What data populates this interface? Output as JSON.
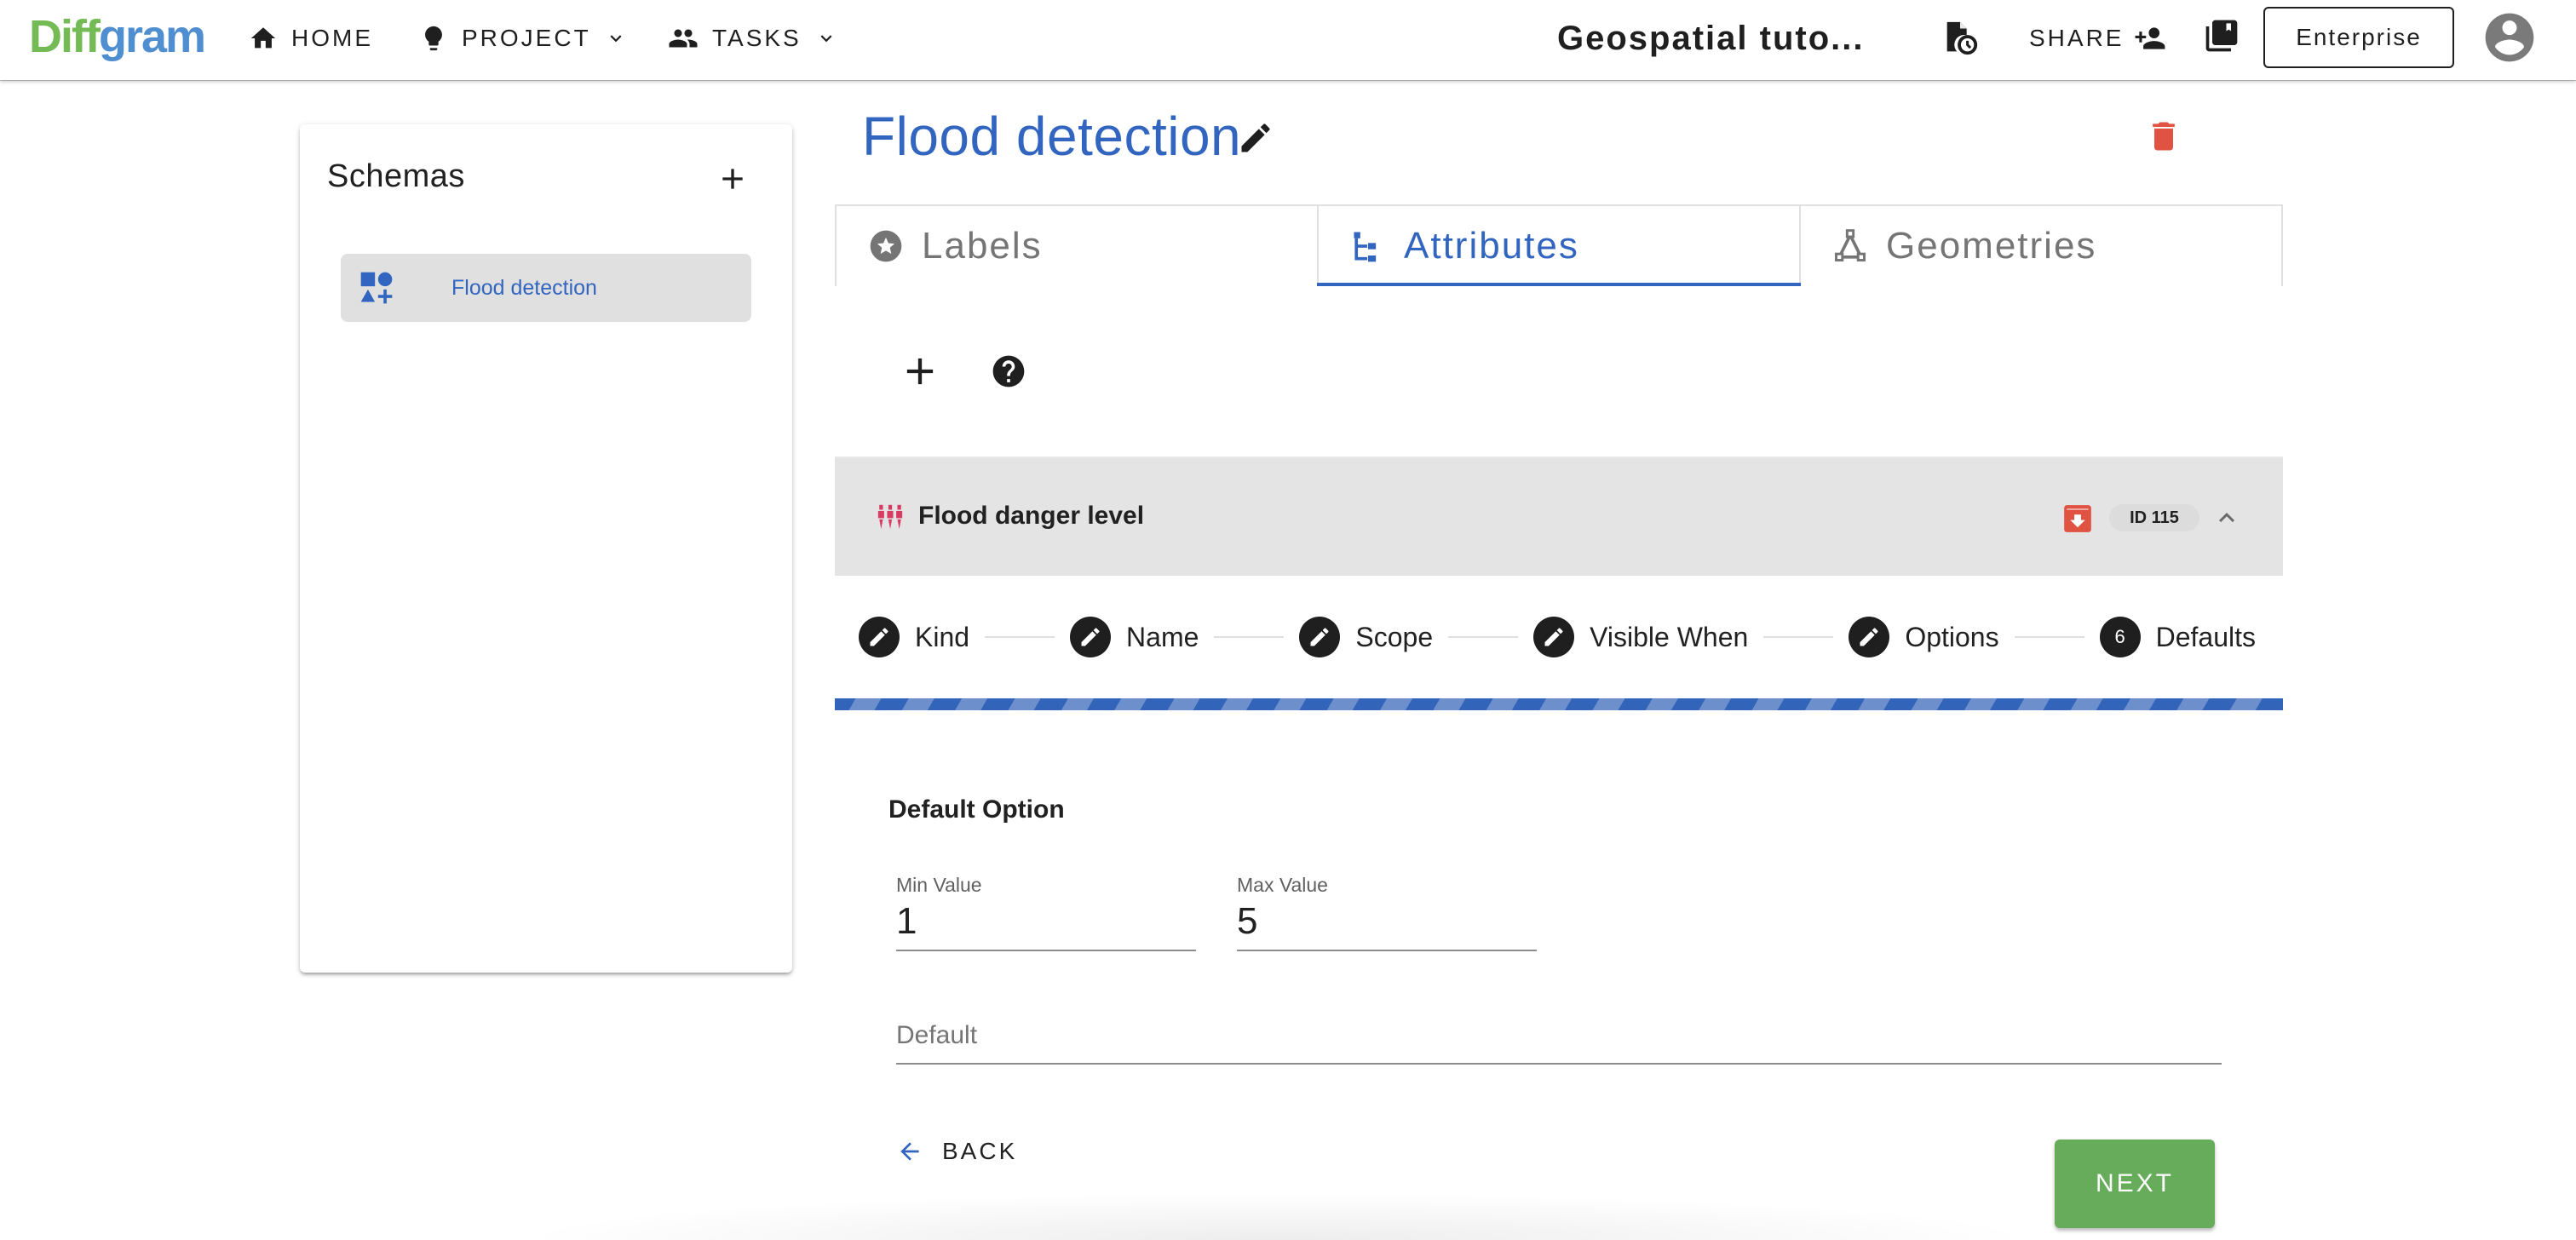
{
  "topbar": {
    "logo_part1": "Diff",
    "logo_part2": "gram",
    "nav": [
      {
        "label": "HOME",
        "icon": "home-icon"
      },
      {
        "label": "PROJECT",
        "icon": "lightbulb-icon",
        "dropdown": true
      },
      {
        "label": "TASKS",
        "icon": "people-icon",
        "dropdown": true
      }
    ],
    "project_title": "Geospatial tuto...",
    "share_label": "SHARE",
    "enterprise_label": "Enterprise"
  },
  "sidebar": {
    "title": "Schemas",
    "items": [
      {
        "label": "Flood detection",
        "icon": "shapes-icon",
        "selected": true
      }
    ]
  },
  "schema": {
    "title": "Flood detection"
  },
  "tabs": [
    {
      "label": "Labels",
      "icon": "star-circle-icon",
      "active": false
    },
    {
      "label": "Attributes",
      "icon": "file-tree-icon",
      "active": true
    },
    {
      "label": "Geometries",
      "icon": "vector-triangle-icon",
      "active": false
    }
  ],
  "attribute": {
    "name": "Flood danger level",
    "id_label": "ID 115"
  },
  "stepper": {
    "steps": [
      {
        "label": "Kind",
        "state": "edit"
      },
      {
        "label": "Name",
        "state": "edit"
      },
      {
        "label": "Scope",
        "state": "edit"
      },
      {
        "label": "Visible When",
        "state": "edit"
      },
      {
        "label": "Options",
        "state": "edit"
      },
      {
        "label": "Defaults",
        "state": "current",
        "number": "6"
      }
    ]
  },
  "defaults_form": {
    "section_title": "Default Option",
    "min_label": "Min Value",
    "min_value": "1",
    "max_label": "Max Value",
    "max_value": "5",
    "default_placeholder": "Default"
  },
  "actions": {
    "back_label": "BACK",
    "next_label": "NEXT"
  },
  "colors": {
    "primary": "#3265c0",
    "logo_green": "#74bb56",
    "logo_blue": "#4f8ed0",
    "danger": "#e05343",
    "success": "#67ac5b"
  }
}
